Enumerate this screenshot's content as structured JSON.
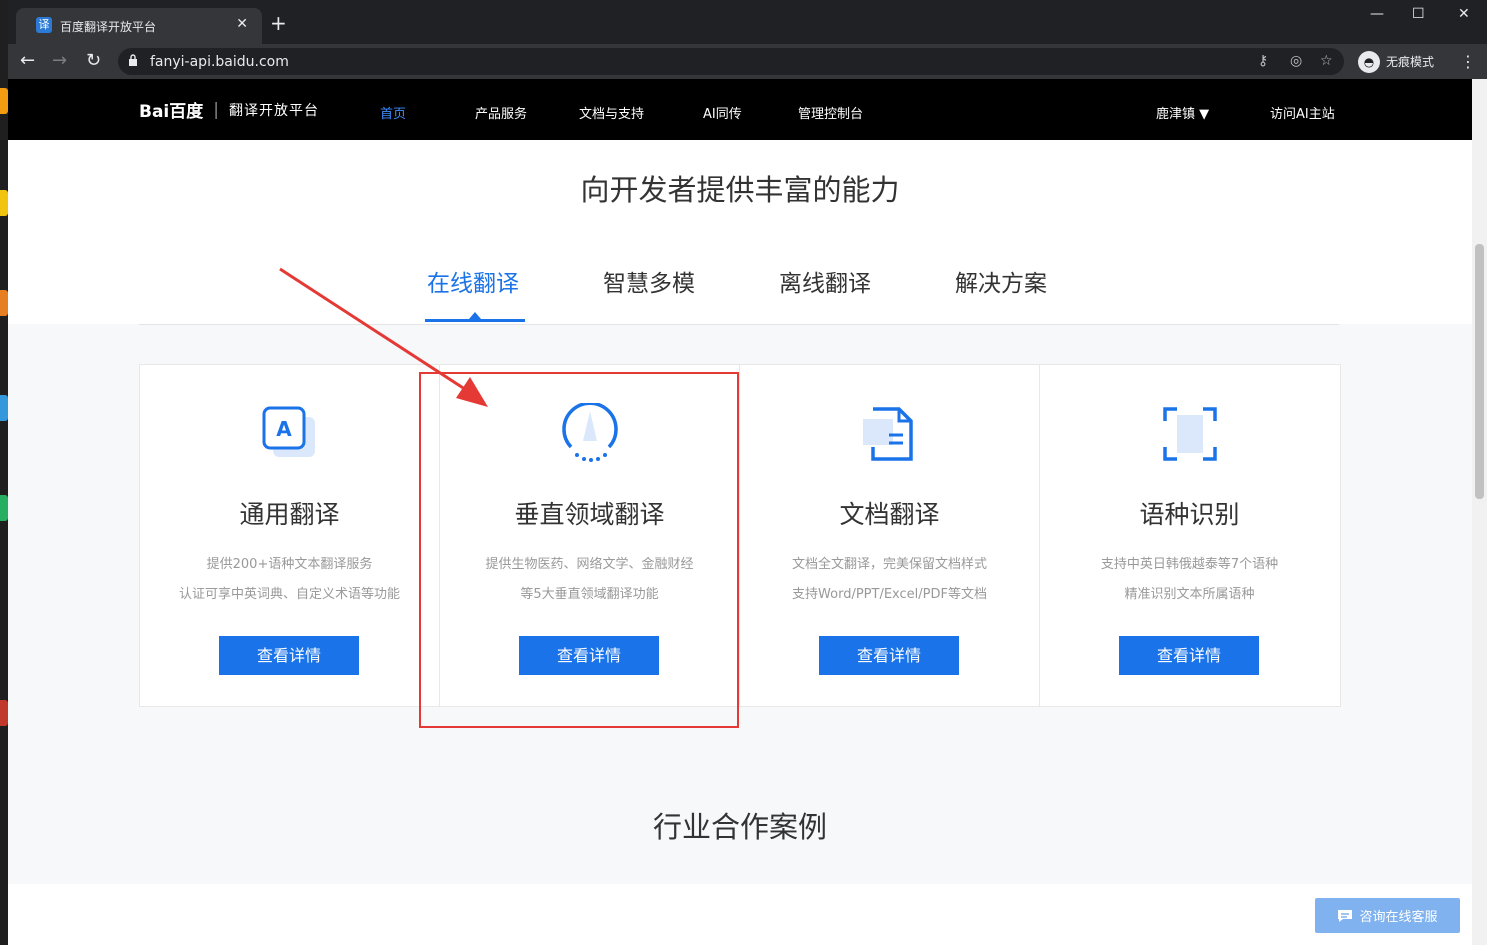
{
  "browser": {
    "tab_title": "百度翻译开放平台",
    "favicon_char": "译",
    "close_char": "✕",
    "newtab_char": "+",
    "url": "fanyi-api.baidu.com",
    "profile_label": "无痕模式",
    "win_min": "—",
    "win_max": "☐",
    "win_close": "✕"
  },
  "header": {
    "logo_brand": "Bai百度",
    "logo_sep": "|",
    "logo_sub": "翻译开放平台",
    "nav": [
      {
        "label": "首页",
        "active": true
      },
      {
        "label": "产品服务"
      },
      {
        "label": "文档与支持"
      },
      {
        "label": "AI同传"
      },
      {
        "label": "管理控制台"
      }
    ],
    "user": "鹿津镇 ▼",
    "visit": "访问AI主站"
  },
  "main": {
    "title": "向开发者提供丰富的能力",
    "tabs": [
      "在线翻译",
      "智慧多模",
      "离线翻译",
      "解决方案"
    ],
    "cards": [
      {
        "icon": "letter-a-icon",
        "title": "通用翻译",
        "line1": "提供200+语种文本翻译服务",
        "line2": "认证可享中英词典、自定义术语等功能",
        "button": "查看详情"
      },
      {
        "icon": "domain-compass-icon",
        "title": "垂直领域翻译",
        "line1": "提供生物医药、网络文学、金融财经",
        "line2": "等5大垂直领域翻译功能",
        "button": "查看详情"
      },
      {
        "icon": "document-icon",
        "title": "文档翻译",
        "line1": "文档全文翻译，完美保留文档样式",
        "line2": "支持Word/PPT/Excel/PDF等文档",
        "button": "查看详情"
      },
      {
        "icon": "scan-frame-icon",
        "title": "语种识别",
        "line1": "支持中英日韩俄越泰等7个语种",
        "line2": "精准识别文本所属语种",
        "button": "查看详情"
      }
    ],
    "section2_title": "行业合作案例",
    "cta": "咨询在线客服"
  },
  "colors": {
    "accent": "#1a73e8",
    "annotation": "#e53935"
  }
}
